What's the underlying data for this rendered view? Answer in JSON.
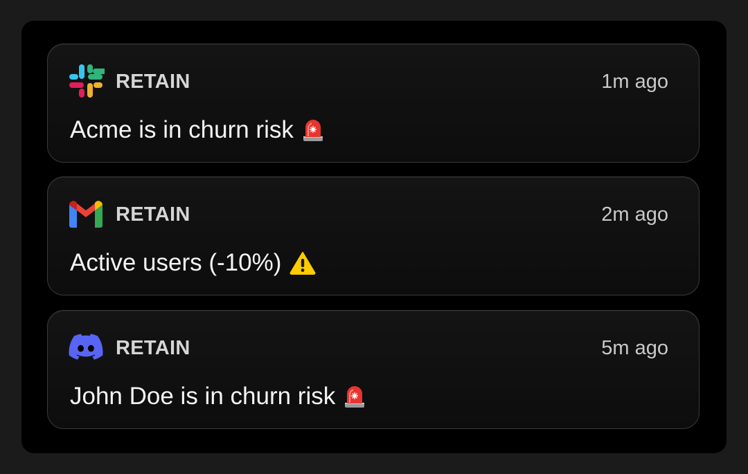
{
  "notifications": [
    {
      "app_icon": "slack-icon",
      "app_name": "RETAIN",
      "time": "1m ago",
      "message": "Acme is in churn risk",
      "emoji": "siren-emoji"
    },
    {
      "app_icon": "gmail-icon",
      "app_name": "RETAIN",
      "time": "2m ago",
      "message": "Active users (-10%)",
      "emoji": "warning-emoji"
    },
    {
      "app_icon": "discord-icon",
      "app_name": "RETAIN",
      "time": "5m ago",
      "message": "John Doe is in churn risk",
      "emoji": "siren-emoji"
    }
  ],
  "colors": {
    "page_background": "#1b1b1b",
    "panel_background": "#000000",
    "card_border": "#3a3a3a",
    "slack_blue": "#36C5F0",
    "slack_green": "#2EB67D",
    "slack_yellow": "#ECB22E",
    "slack_red": "#E01E5A",
    "gmail_red": "#EA4335",
    "gmail_blue": "#4285F4",
    "gmail_green": "#34A853",
    "gmail_yellow": "#FBBC04",
    "discord_blurple": "#5865F2",
    "warning_yellow": "#FFCC00"
  }
}
